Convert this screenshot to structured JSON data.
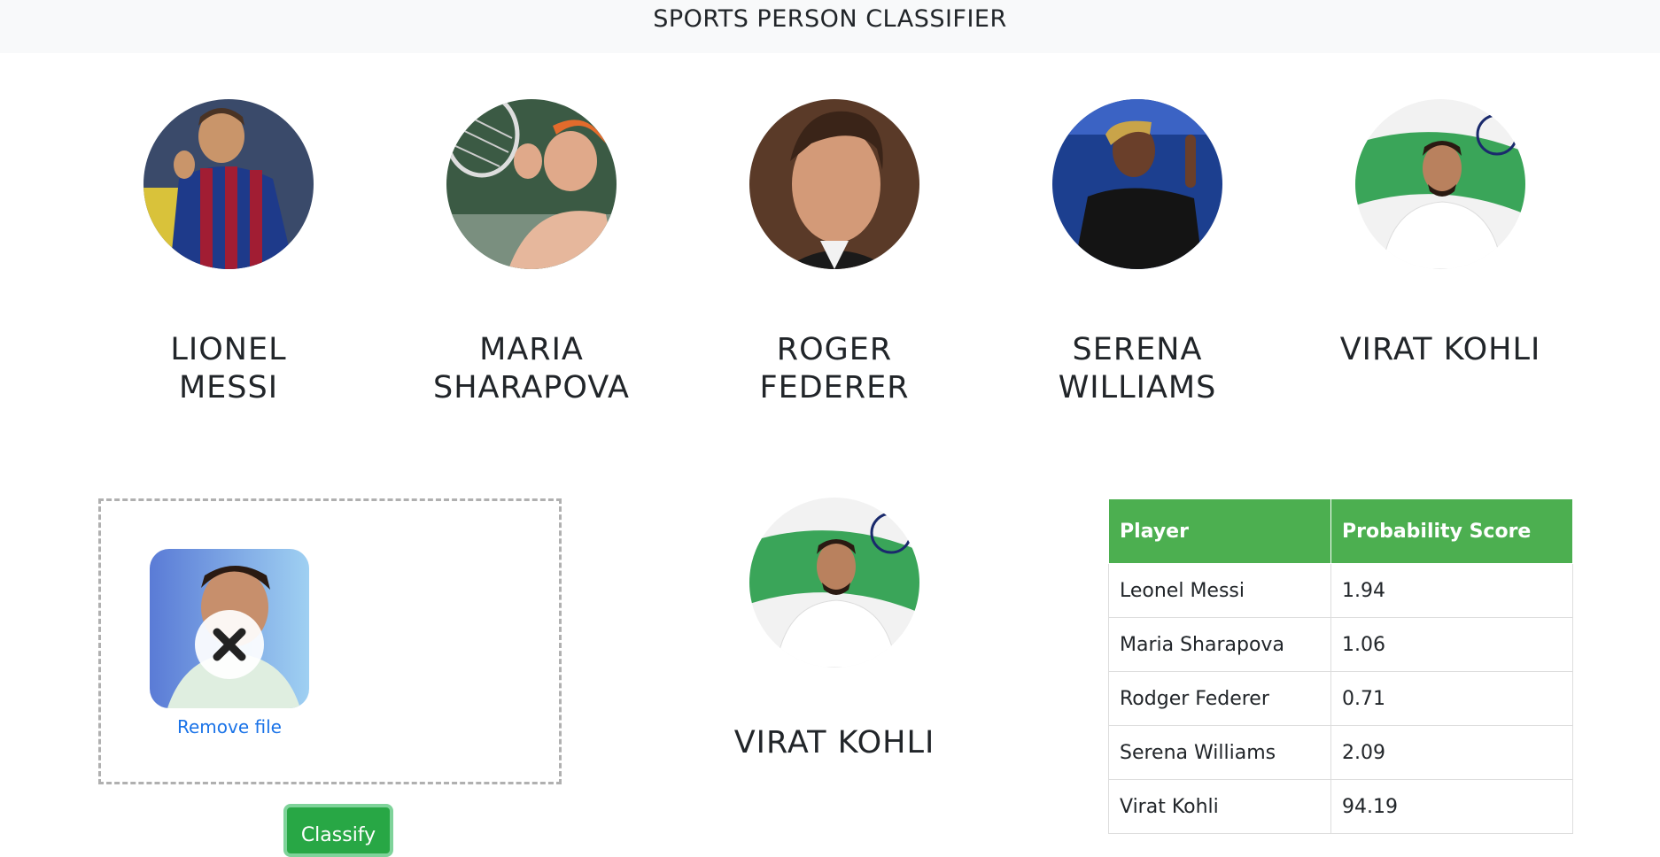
{
  "header": {
    "title": "SPORTS PERSON CLASSIFIER"
  },
  "players": [
    {
      "line1": "LIONEL",
      "line2": "MESSI"
    },
    {
      "line1": "MARIA",
      "line2": "SHARAPOVA"
    },
    {
      "line1": "ROGER",
      "line2": "FEDERER"
    },
    {
      "line1": "SERENA",
      "line2": "WILLIAMS"
    },
    {
      "line1": "VIRAT KOHLI",
      "line2": ""
    }
  ],
  "upload": {
    "remove_label": "Remove file",
    "remove_icon": "close-icon",
    "classify_label": "Classify"
  },
  "result": {
    "name": "VIRAT KOHLI"
  },
  "scores_table": {
    "headers": [
      "Player",
      "Probability Score"
    ],
    "rows": [
      [
        "Leonel Messi",
        "1.94"
      ],
      [
        "Maria Sharapova",
        "1.06"
      ],
      [
        "Rodger Federer",
        "0.71"
      ],
      [
        "Serena Williams",
        "2.09"
      ],
      [
        "Virat Kohli",
        "94.19"
      ]
    ]
  },
  "colors": {
    "header_bg": "#f8f9fa",
    "table_header": "#4caf50",
    "button": "#28a745",
    "link": "#1a73e8"
  }
}
